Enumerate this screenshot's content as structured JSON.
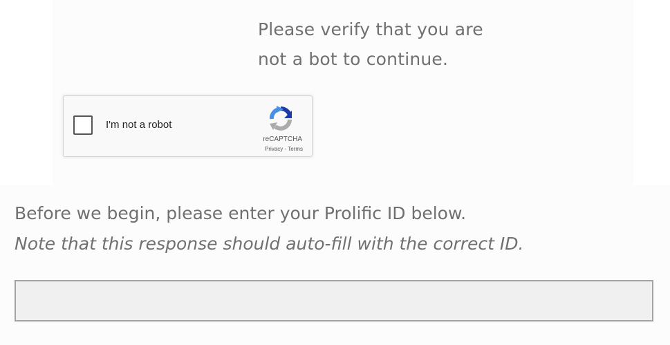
{
  "captcha": {
    "prompt_line1": "Please verify that you are",
    "prompt_line2": "not a bot to continue.",
    "widget": {
      "checkbox_label": "I'm not a robot",
      "brand": "reCAPTCHA",
      "privacy_link": "Privacy",
      "separator": " - ",
      "terms_link": "Terms",
      "logo_icon": "recaptcha-logo-icon",
      "checked": false
    }
  },
  "prolific_id": {
    "question_line1": "Before we begin, please enter your Prolific ID below.",
    "question_note": "Note that this response should auto-fill with the correct ID.",
    "input_value": ""
  },
  "colors": {
    "text_gray": "#707070",
    "input_bg": "#f0f0f0",
    "input_border": "#a3a3a3",
    "recaptcha_blue": "#1c3aa9",
    "recaptcha_lightblue": "#4a90e2",
    "recaptcha_gray": "#ababab"
  }
}
